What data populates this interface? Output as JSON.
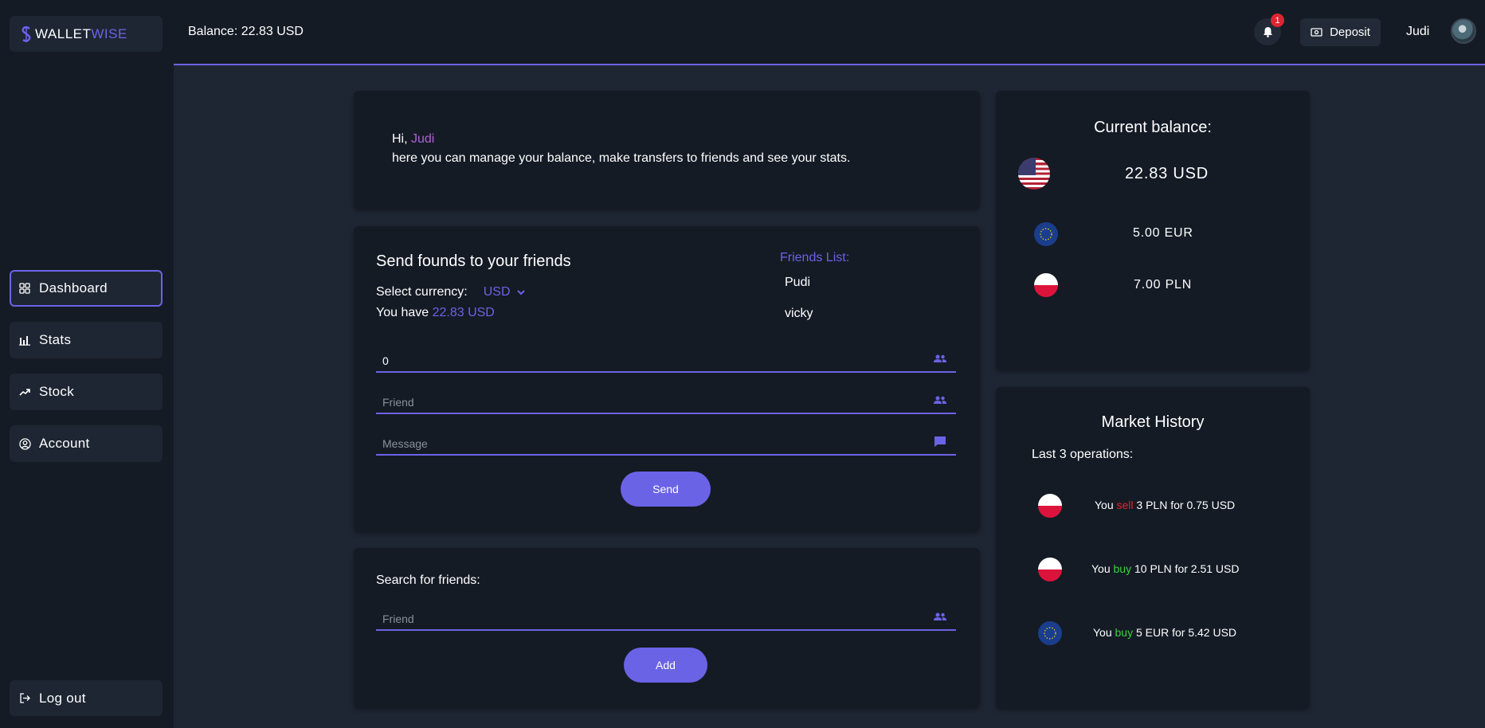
{
  "app": {
    "logo_part1": "WALLET",
    "logo_part2": "WISE",
    "accent_color": "#6b63e6"
  },
  "sidebar": {
    "items": [
      {
        "label": "Dashboard",
        "icon": "grid-icon",
        "active": true
      },
      {
        "label": "Stats",
        "icon": "bar-chart-icon",
        "active": false
      },
      {
        "label": "Stock",
        "icon": "trending-up-icon",
        "active": false
      },
      {
        "label": "Account",
        "icon": "user-circle-icon",
        "active": false
      }
    ],
    "logout_label": "Log out"
  },
  "header": {
    "balance": "Balance: 22.83 USD",
    "notification_count": "1",
    "deposit_label": "Deposit",
    "username": "Judi"
  },
  "greeting": {
    "hi": "Hi, ",
    "name": "Judi",
    "text": "here you can manage your balance, make transfers to friends and see your stats."
  },
  "send": {
    "title": "Send founds to your friends",
    "currency_label": "Select currency:",
    "currency_value": "USD",
    "have_prefix": "You have ",
    "have_amount": "22.83 USD",
    "amount_value": "0",
    "friend_placeholder": "Friend",
    "message_placeholder": "Message",
    "send_label": "Send",
    "friends_list_title": "Friends List:",
    "friends": [
      "Pudi",
      "vicky"
    ]
  },
  "search": {
    "label": "Search for friends:",
    "friend_placeholder": "Friend",
    "add_label": "Add"
  },
  "balance_card": {
    "title": "Current balance:",
    "rows": [
      {
        "flag": "us-flag",
        "amount": "22.83 USD"
      },
      {
        "flag": "eu-flag",
        "amount": "5.00 EUR"
      },
      {
        "flag": "pl-flag",
        "amount": "7.00 PLN"
      }
    ]
  },
  "market": {
    "title": "Market History",
    "subtitle": "Last 3 operations:",
    "operations": [
      {
        "flag": "pl-flag",
        "prefix": "You ",
        "action": "sell",
        "rest": " 3 PLN for 0.75 USD",
        "action_color": "#e0242f"
      },
      {
        "flag": "pl-flag",
        "prefix": "You ",
        "action": "buy",
        "rest": " 10 PLN for 2.51 USD",
        "action_color": "#37d33a"
      },
      {
        "flag": "eu-flag",
        "prefix": "You ",
        "action": "buy",
        "rest": " 5 EUR for 5.42 USD",
        "action_color": "#37d33a"
      }
    ]
  }
}
